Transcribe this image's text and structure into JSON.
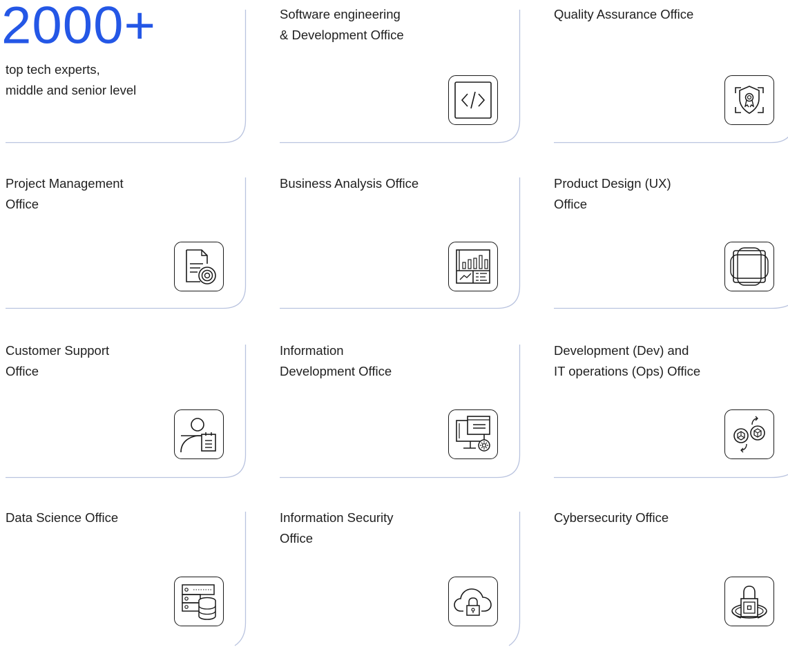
{
  "hero": {
    "number": "2000+",
    "lines": [
      "top tech experts,",
      "middle and senior level"
    ]
  },
  "offices": [
    {
      "lines": [
        "Software engineering",
        "& Development Office"
      ],
      "icon": "code-icon"
    },
    {
      "lines": [
        "Quality Assurance Office"
      ],
      "icon": "quality-shield-icon"
    },
    {
      "lines": [
        "Project Management",
        "Office"
      ],
      "icon": "document-target-icon"
    },
    {
      "lines": [
        "Business Analysis Office"
      ],
      "icon": "analytics-dashboard-icon"
    },
    {
      "lines": [
        "Product Design (UX)",
        "Office"
      ],
      "icon": "design-shapes-icon"
    },
    {
      "lines": [
        "Customer Support",
        "Office"
      ],
      "icon": "support-person-icon"
    },
    {
      "lines": [
        "Information",
        "Development Office"
      ],
      "icon": "computer-gear-icon"
    },
    {
      "lines": [
        "Development (Dev) and",
        "IT operations (Ops) Office"
      ],
      "icon": "devops-cycle-icon"
    },
    {
      "lines": [
        "Data Science Office"
      ],
      "icon": "database-server-icon"
    },
    {
      "lines": [
        "Information Security",
        "Office"
      ],
      "icon": "cloud-lock-icon"
    },
    {
      "lines": [
        "Cybersecurity Office"
      ],
      "icon": "padlock-orbit-icon"
    }
  ],
  "colors": {
    "accent": "#2457e6",
    "border": "#b9c3df",
    "icon_stroke": "#1a1a1a"
  }
}
